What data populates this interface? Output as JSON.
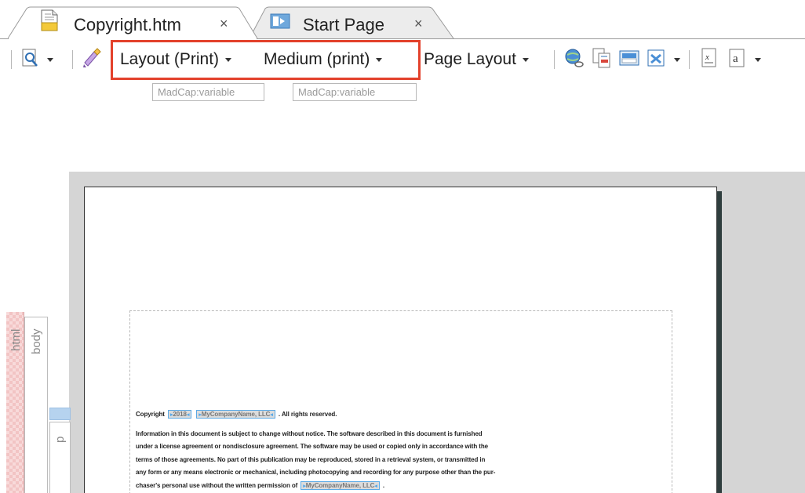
{
  "tabs": [
    {
      "label": "Copyright.htm",
      "close": "×",
      "icon": "html-file-icon"
    },
    {
      "label": "Start Page",
      "close": "×",
      "icon": "start-page-icon"
    }
  ],
  "toolbar": {
    "layout_label": "Layout (Print)",
    "medium_label": "Medium (print)",
    "page_layout_label": "Page Layout"
  },
  "variables": [
    "MadCap:variable",
    "MadCap:variable"
  ],
  "structure": {
    "html": "html",
    "body": "body",
    "p": "p"
  },
  "document": {
    "copyright_prefix": "Copyright",
    "year_var": "2018",
    "company_var": "MyCompanyName, LLC",
    "rights": ". All rights reserved.",
    "paragraph_lines": [
      "Information in this document is subject to change without notice. The software described in this document is furnished",
      "under a license agreement or nondisclosure agreement. The software may be used or copied only in accordance with the",
      "terms of those agreements. No part of this publication may be reproduced, stored in a retrieval system, or transmitted in",
      "any form or any means electronic or mechanical, including photocopying and recording for any purpose other than the pur-"
    ],
    "last_line_prefix": "chaser's personal use without the written permission of",
    "last_line_var": "MyCompanyName, LLC",
    "last_line_suffix": "."
  },
  "colors": {
    "highlight": "#e3412b",
    "accent_blue": "#5aa9e6"
  }
}
